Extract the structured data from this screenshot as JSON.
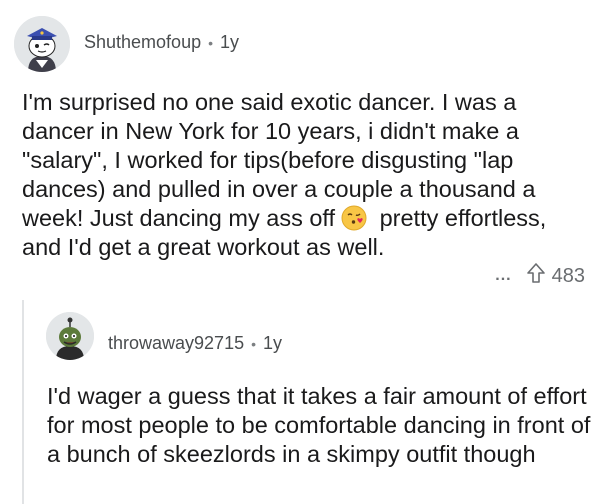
{
  "comments": [
    {
      "username": "Shuthemofoup",
      "age": "1y",
      "text_part1": "I'm surprised no one said exotic dancer.  I was a dancer in New York for 10 years, i didn't make a \"salary\", I worked for tips(before disgusting \"lap dances) and pulled in over a couple a thousand a week!  Just dancing my ass off",
      "emoji": "kissing-face-emoji",
      "text_part2": " pretty effortless, and I'd get a great workout as well.",
      "upvotes": "483",
      "more_label": "..."
    },
    {
      "username": "throwaway92715",
      "age": "1y",
      "text": "I'd wager a guess that it takes a fair amount of effort for most people to be comfortable dancing in front of a bunch of skeezlords in a skimpy outfit though"
    }
  ],
  "colors": {
    "text": "#1a1a1b",
    "meta": "#4a4d4f",
    "avatar_bg": "#e3e6e8"
  }
}
